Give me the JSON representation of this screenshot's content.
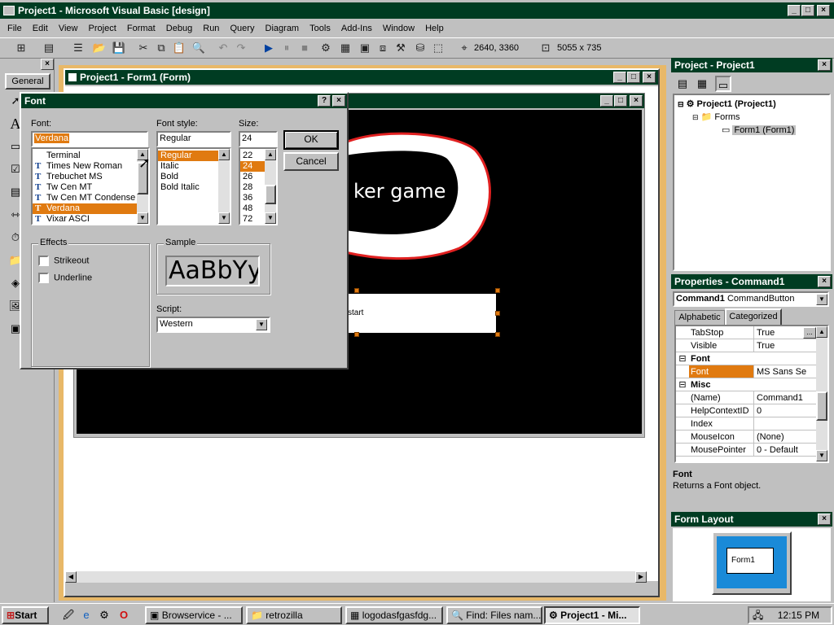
{
  "app": {
    "title": "Project1 - Microsoft Visual Basic [design]",
    "window_buttons": [
      "_",
      "□",
      "×"
    ]
  },
  "menu": [
    "File",
    "Edit",
    "View",
    "Project",
    "Format",
    "Debug",
    "Run",
    "Query",
    "Diagram",
    "Tools",
    "Add-Ins",
    "Window",
    "Help"
  ],
  "toolbar": {
    "position": "2640, 3360",
    "size": "5055 x 735"
  },
  "toolbox": {
    "tab_label": "General"
  },
  "form_window": {
    "title": "Project1 - Form1 (Form)",
    "inner_title_buttons": [
      "_",
      "□",
      "×"
    ],
    "canvas_bg": "#000000",
    "game_text": "ker game",
    "command_caption": "start"
  },
  "font_dialog": {
    "title": "Font",
    "font_label": "Font:",
    "font_value": "Verdana",
    "fonts": [
      "Terminal",
      "Times New Roman",
      "Trebuchet MS",
      "Tw Cen MT",
      "Tw Cen MT Condense",
      "Verdana",
      "Vixar ASCI"
    ],
    "style_label": "Font style:",
    "style_value": "Regular",
    "styles": [
      "Regular",
      "Italic",
      "Bold",
      "Bold Italic"
    ],
    "size_label": "Size:",
    "size_value": "24",
    "sizes": [
      "22",
      "24",
      "26",
      "28",
      "36",
      "48",
      "72"
    ],
    "ok_label": "OK",
    "cancel_label": "Cancel",
    "effects_label": "Effects",
    "strikeout_label": "Strikeout",
    "underline_label": "Underline",
    "sample_label": "Sample",
    "sample_text": "AaBbYy",
    "script_label": "Script:",
    "script_value": "Western",
    "help_button": "?",
    "close_button": "×"
  },
  "project_panel": {
    "title": "Project - Project1",
    "root": "Project1 (Project1)",
    "folder": "Forms",
    "item": "Form1 (Form1)"
  },
  "properties_panel": {
    "title": "Properties - Command1",
    "object_name": "Command1",
    "object_type": "CommandButton",
    "tabs": [
      "Alphabetic",
      "Categorized"
    ],
    "rows": [
      {
        "exp": "",
        "name": "TabStop",
        "value": "True",
        "cat": false
      },
      {
        "exp": "",
        "name": "Visible",
        "value": "True",
        "cat": false
      },
      {
        "exp": "⊟",
        "name": "Font",
        "value": "",
        "cat": true
      },
      {
        "exp": "",
        "name": "Font",
        "value": "MS Sans Se",
        "cat": false,
        "selected": true
      },
      {
        "exp": "⊟",
        "name": "Misc",
        "value": "",
        "cat": true
      },
      {
        "exp": "",
        "name": "(Name)",
        "value": "Command1",
        "cat": false
      },
      {
        "exp": "",
        "name": "HelpContextID",
        "value": "0",
        "cat": false
      },
      {
        "exp": "",
        "name": "Index",
        "value": "",
        "cat": false
      },
      {
        "exp": "",
        "name": "MouseIcon",
        "value": "(None)",
        "cat": false
      },
      {
        "exp": "",
        "name": "MousePointer",
        "value": "0 - Default",
        "cat": false
      }
    ],
    "desc_title": "Font",
    "desc_text": "Returns a Font object."
  },
  "form_layout_panel": {
    "title": "Form Layout",
    "form_label": "Form1"
  },
  "taskbar": {
    "start_label": "Start",
    "items": [
      "Browservice - ...",
      "retrozilla",
      "logodasfgasfdg...",
      "Find: Files nam...",
      "Project1 - Mi..."
    ],
    "clock": "12:15 PM"
  },
  "colors": {
    "title_active": "#003c22",
    "selection": "#e07a10",
    "desktop_frame": "#e8b868"
  }
}
